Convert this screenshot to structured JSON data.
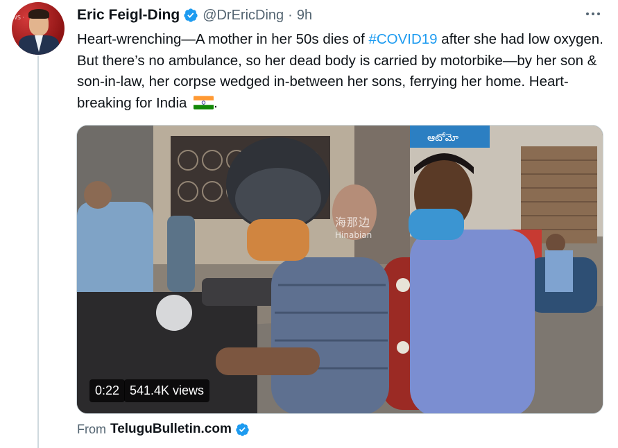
{
  "author": {
    "display_name": "Eric Feigl-Ding",
    "handle": "@DrEricDing",
    "separator": "·",
    "time": "9h",
    "verified_icon": "verified-badge-icon",
    "avatar_overlay_text": "WS ·"
  },
  "more_menu_icon": "more-horizontal-icon",
  "tweet_text": {
    "part1": "Heart-wrenching—A mother in her 50s dies of ",
    "hashtag": "#COVID19",
    "part2": " after she had low oxygen. But there’s no ambulance, so her dead body is carried by motorbike—by her son & son-in-law, her corpse wedged in-between her sons, ferrying her home. Heart-breaking for India ",
    "emoji_icon": "india-flag-icon",
    "part3": "."
  },
  "media": {
    "type": "video",
    "duration": "0:22",
    "views": "541.4K views",
    "watermark_cn": "海那边",
    "watermark_en": "Hinabian",
    "background_sign_text": "ఆటోమో"
  },
  "source": {
    "prefix": "From",
    "name": "TeluguBulletin.com",
    "verified_icon": "verified-badge-icon"
  },
  "colors": {
    "link_blue": "#1d9bf0",
    "secondary_text": "#536471",
    "primary_text": "#0f1419"
  }
}
